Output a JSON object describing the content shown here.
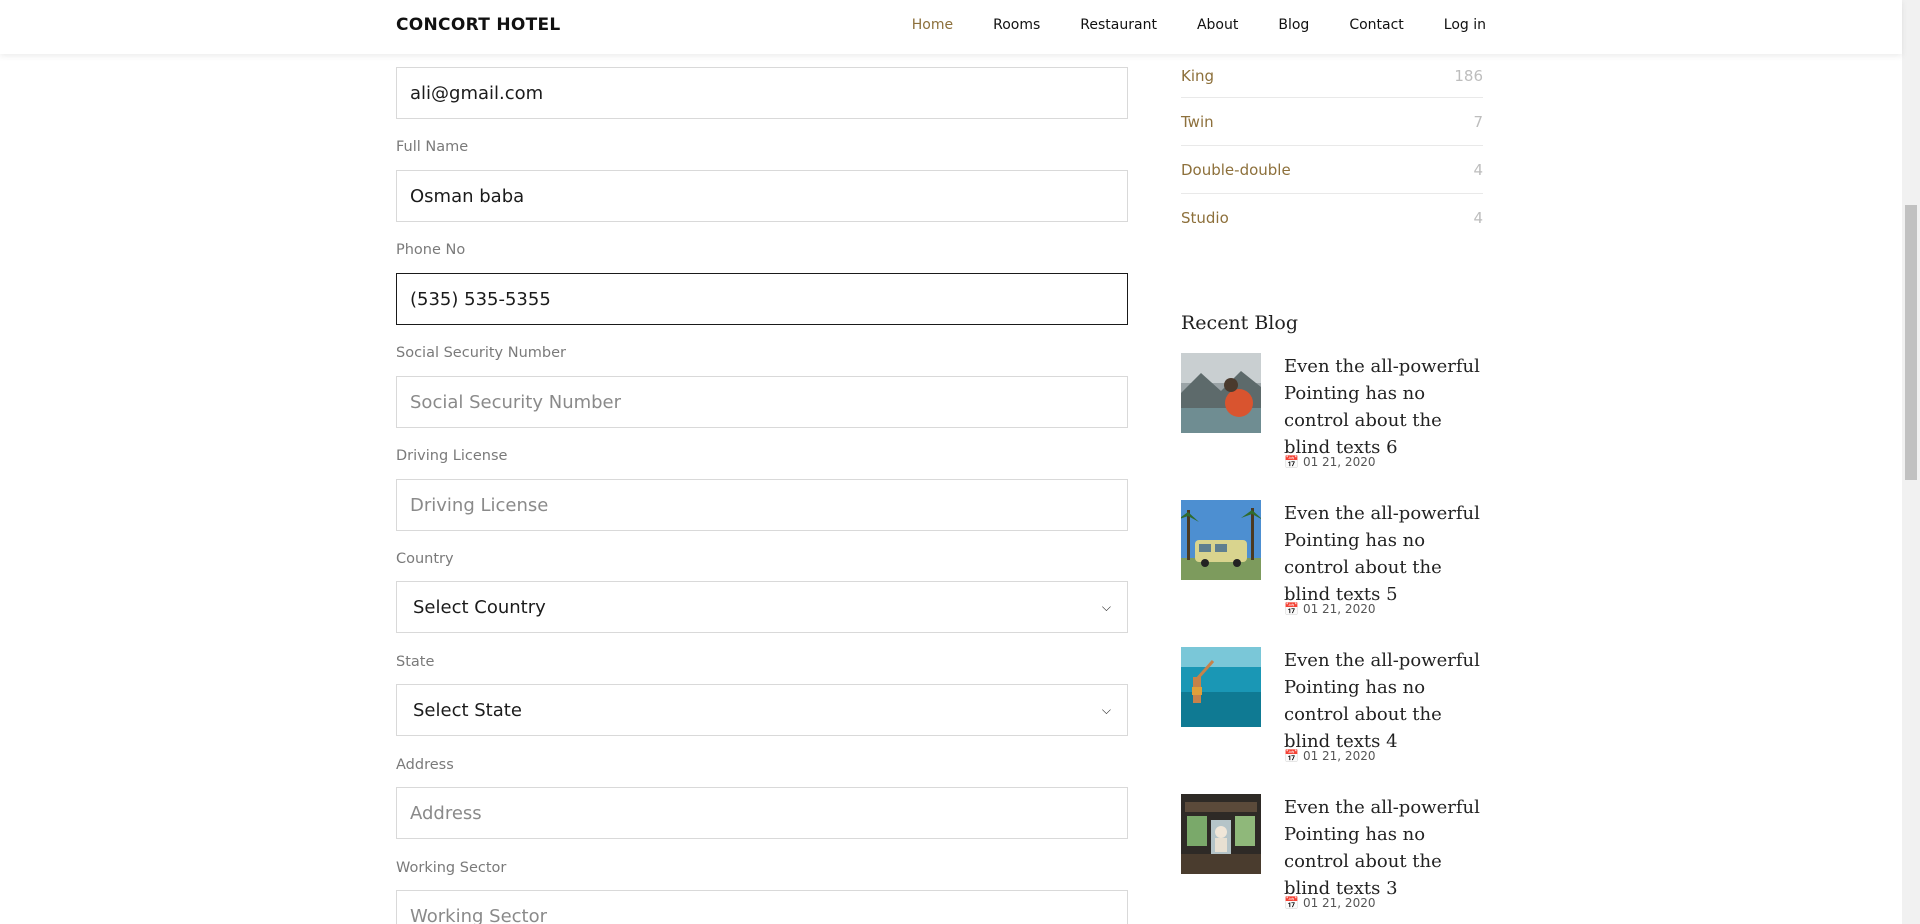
{
  "brand": "CONCORT HOTEL",
  "nav": [
    {
      "label": "Home",
      "active": true
    },
    {
      "label": "Rooms"
    },
    {
      "label": "Restaurant"
    },
    {
      "label": "About"
    },
    {
      "label": "Blog"
    },
    {
      "label": "Contact"
    },
    {
      "label": "Log in"
    }
  ],
  "form": {
    "email": {
      "value": "ali@gmail.com"
    },
    "full_name": {
      "label": "Full Name",
      "value": "Osman baba"
    },
    "phone": {
      "label": "Phone No",
      "value": "(535) 535-5355"
    },
    "ssn": {
      "label": "Social Security Number",
      "placeholder": "Social Security Number"
    },
    "license": {
      "label": "Driving License",
      "placeholder": "Driving License"
    },
    "country": {
      "label": "Country",
      "selected": "Select Country"
    },
    "state": {
      "label": "State",
      "selected": "Select State"
    },
    "address": {
      "label": "Address",
      "placeholder": "Address"
    },
    "sector": {
      "label": "Working Sector",
      "placeholder": "Working Sector"
    }
  },
  "categories": [
    {
      "name": "King",
      "count": "186"
    },
    {
      "name": "Twin",
      "count": "7"
    },
    {
      "name": "Double-double",
      "count": "4"
    },
    {
      "name": "Studio",
      "count": "4"
    }
  ],
  "recent_blog": {
    "title": "Recent Blog",
    "posts": [
      {
        "title": "Even the all-powerful Pointing has no control about the blind texts 6",
        "date": "01 21, 2020"
      },
      {
        "title": "Even the all-powerful Pointing has no control about the blind texts 5",
        "date": "01 21, 2020"
      },
      {
        "title": "Even the all-powerful Pointing has no control about the blind texts 4",
        "date": "01 21, 2020"
      },
      {
        "title": "Even the all-powerful Pointing has no control about the blind texts 3",
        "date": "01 21, 2020"
      }
    ]
  },
  "colors": {
    "accent": "#8d703b"
  }
}
